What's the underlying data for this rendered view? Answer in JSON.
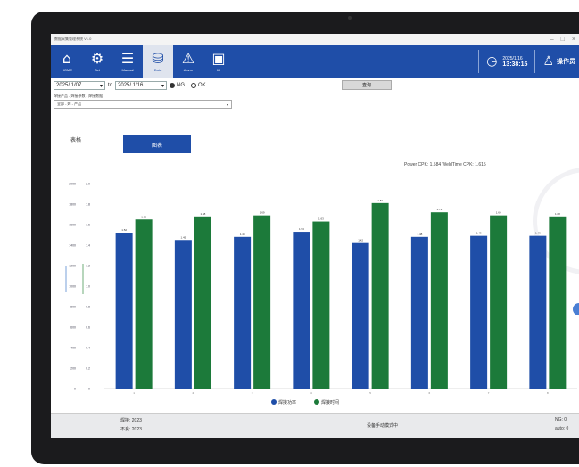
{
  "app": {
    "title": "数据采集管理系统 V1.0",
    "window_controls": [
      "–",
      "□",
      "×"
    ]
  },
  "nav": {
    "items": [
      {
        "label": "HOME",
        "icon": "home-icon",
        "glyph": "⌂"
      },
      {
        "label": "Set",
        "icon": "settings-icon",
        "glyph": "⚙"
      },
      {
        "label": "Manual",
        "icon": "manual-icon",
        "glyph": "☰"
      },
      {
        "label": "Data",
        "icon": "database-icon",
        "glyph": "⛁"
      },
      {
        "label": "Alarm",
        "icon": "alarm-icon",
        "glyph": "⚠"
      },
      {
        "label": "IO",
        "icon": "io-icon",
        "glyph": "▣"
      }
    ],
    "active_index": 3,
    "date": "2025/1/16",
    "time": "13:38:15",
    "user": "操作员"
  },
  "filters": {
    "from_date": "2025/ 1/07",
    "to_word": "to",
    "to_date": "2025/ 1/16",
    "radio_all": "NG",
    "radio_ok": "OK",
    "query_label": "查询"
  },
  "crumb": "焊接产品 - 焊接参数 - 焊接数据",
  "select_value": "全部 - 焊 - 产品",
  "view_toggle": {
    "table": "表格",
    "chart": "图表"
  },
  "cpk_text": "Power CPK: 1.584    WeldTime CPK: 1.615",
  "chart_data": {
    "type": "bar",
    "categories": [
      "1",
      "2",
      "3",
      "4",
      "5",
      "6",
      "7",
      "8"
    ],
    "series": [
      {
        "name": "焊接功率",
        "color": "#1f4ea8",
        "values": [
          1.52,
          1.45,
          1.48,
          1.53,
          1.42,
          1.48,
          1.49,
          1.49
        ]
      },
      {
        "name": "焊接时间",
        "color": "#1c7a3a",
        "values": [
          1.65,
          1.68,
          1.69,
          1.63,
          1.81,
          1.72,
          1.69,
          1.68
        ]
      }
    ],
    "data_labels": {
      "series_0": [
        "1.52",
        "1.45",
        "1.48",
        "1.53",
        "1.42",
        "1.48",
        "1.49",
        "1.49"
      ],
      "series_1": [
        "1.65",
        "1.68",
        "1.69",
        "1.63",
        "1.81",
        "1.72",
        "1.69",
        "1.68"
      ]
    },
    "ylim": [
      0,
      2.0
    ],
    "yticks": [
      "2.0",
      "1.8",
      "1.6",
      "1.4",
      "1.2",
      "1.0",
      "0.8",
      "0.6",
      "0.4",
      "0.2",
      "0"
    ],
    "y2ticks": [
      "2000",
      "1800",
      "1600",
      "1400",
      "1200",
      "1000",
      "800",
      "600",
      "400",
      "200",
      "0"
    ],
    "legend_position": "bottom"
  },
  "bottom": {
    "count_a": "焊接: 2023",
    "count_b": "不良: 2023",
    "status": "设备手动模式中",
    "right_a": "NG: 0",
    "right_b": "auto: 0"
  }
}
